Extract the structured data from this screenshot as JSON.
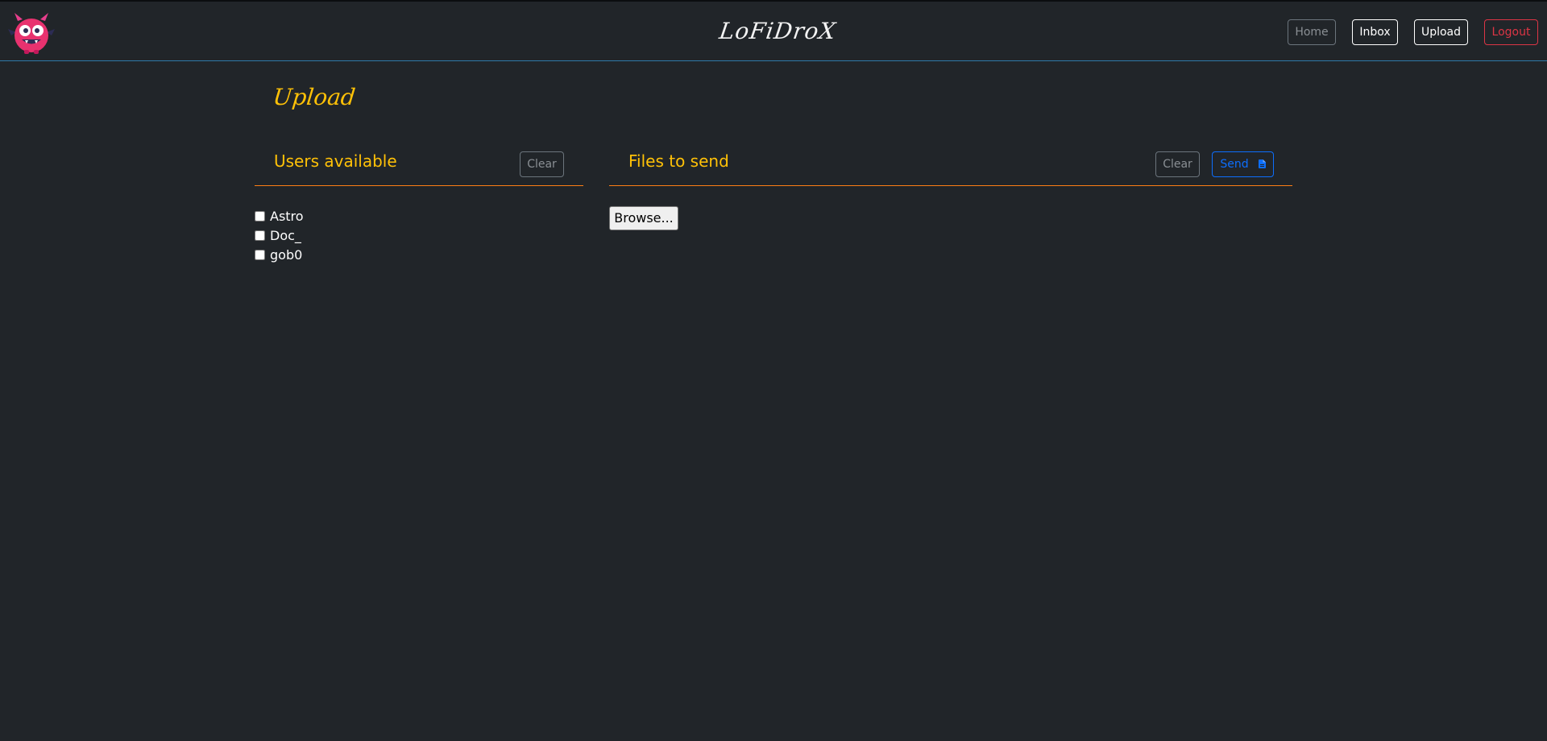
{
  "app": {
    "brand": "LoFiDroX",
    "logo_icon": "pink-monster-logo-icon"
  },
  "nav": {
    "home": "Home",
    "inbox": "Inbox",
    "upload": "Upload",
    "logout": "Logout"
  },
  "page": {
    "title": "Upload"
  },
  "users_panel": {
    "title": "Users available",
    "clear_label": "Clear",
    "users": [
      {
        "name": "Astro",
        "checked": false
      },
      {
        "name": "Doc_",
        "checked": false
      },
      {
        "name": "gob0",
        "checked": false
      }
    ]
  },
  "files_panel": {
    "title": "Files to send",
    "clear_label": "Clear",
    "send_label": "Send",
    "send_icon": "file-icon",
    "browse_label": "Browse..."
  },
  "colors": {
    "background": "#212529",
    "accent_yellow": "#ffc107",
    "divider_orange": "#fd7e14",
    "primary_blue": "#0d6efd",
    "danger_red": "#dc3545",
    "muted_gray": "#6c757d"
  }
}
